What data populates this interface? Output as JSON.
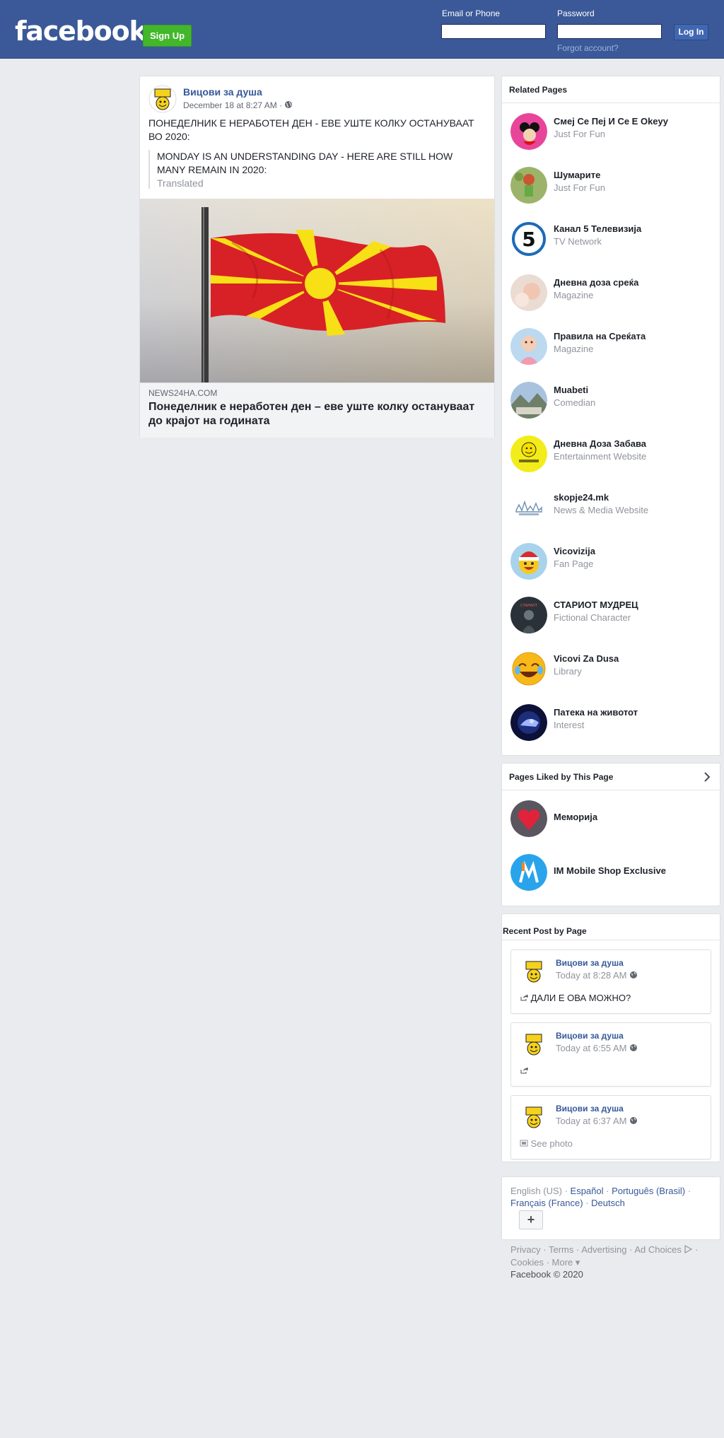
{
  "header": {
    "logo": "facebook",
    "signup_label": "Sign Up",
    "email_label": "Email or Phone",
    "password_label": "Password",
    "login_label": "Log In",
    "forgot_label": "Forgot account?",
    "bg_color": "#3b5998"
  },
  "post": {
    "author": "Вицови за душа",
    "time": "December 18 at 8:27 AM ·",
    "privacy_icon": "globe-icon",
    "text": "ПОНЕДЕЛНИК Е НЕРАБОТЕН ДЕН - ЕВЕ УШТЕ КОЛКУ ОСТАНУВААТ ВО 2020:",
    "translation": "MONDAY IS AN UNDERSTANDING DAY - HERE ARE STILL HOW MANY REMAIN IN 2020:",
    "translated_label": "Translated",
    "link_domain": "NEWS24HA.COM",
    "link_title": "Понеделник е неработен ден – еве уште колку остануваат до крајот на годината"
  },
  "related": {
    "title": "Related Pages",
    "items": [
      {
        "name": "Смеј Се Пеј И Се Е Okeyy",
        "category": "Just For Fun"
      },
      {
        "name": "Шумарите",
        "category": "Just For Fun"
      },
      {
        "name": "Канал 5 Телевизија",
        "category": "TV Network"
      },
      {
        "name": "Дневна доза среќа",
        "category": "Magazine"
      },
      {
        "name": "Правила на Среќата",
        "category": "Magazine"
      },
      {
        "name": "Muabeti",
        "category": "Comedian"
      },
      {
        "name": "Дневна Доза Забава",
        "category": "Entertainment Website"
      },
      {
        "name": "skopje24.mk",
        "category": "News & Media Website"
      },
      {
        "name": "Vicovizija",
        "category": "Fan Page"
      },
      {
        "name": "СТАРИОТ МУДРЕЦ",
        "category": "Fictional Character"
      },
      {
        "name": "Vicovi Za Dusa",
        "category": "Library"
      },
      {
        "name": "Патека на животот",
        "category": "Interest"
      }
    ]
  },
  "liked": {
    "title": "Pages Liked by This Page",
    "items": [
      {
        "name": "Меморија"
      },
      {
        "name": "IM Mobile Shop Exclusive"
      }
    ]
  },
  "recent": {
    "title": "Recent Post by Page",
    "posts": [
      {
        "author": "Вицови за душа",
        "time": "Today at 8:28 AM",
        "body": "ДАЛИ Е ОВА МОЖНО?",
        "body_icon": "share-icon"
      },
      {
        "author": "Вицови за душа",
        "time": "Today at 6:55 AM",
        "body": "",
        "body_icon": "share-icon"
      },
      {
        "author": "Вицови за душа",
        "time": "Today at 6:37 AM",
        "body": "See photo",
        "body_icon": "photo-icon"
      }
    ]
  },
  "languages": {
    "current": "English (US)",
    "others": [
      "Español",
      "Português (Brasil)",
      "Français (France)",
      "Deutsch"
    ],
    "more_label": "+"
  },
  "footer": {
    "links": [
      "Privacy",
      "Terms",
      "Advertising",
      "Ad Choices",
      "Cookies",
      "More"
    ],
    "copyright": "Facebook © 2020"
  }
}
